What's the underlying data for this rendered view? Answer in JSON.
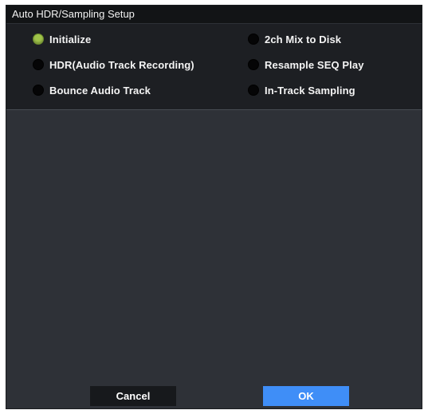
{
  "dialog": {
    "title": "Auto HDR/Sampling Setup"
  },
  "options": {
    "left_column": [
      {
        "label": "Initialize",
        "selected": true
      },
      {
        "label": "HDR(Audio Track Recording)",
        "selected": false
      },
      {
        "label": "Bounce Audio Track",
        "selected": false
      }
    ],
    "right_column": [
      {
        "label": "2ch Mix to Disk",
        "selected": false
      },
      {
        "label": "Resample SEQ Play",
        "selected": false
      },
      {
        "label": "In-Track Sampling",
        "selected": false
      }
    ]
  },
  "buttons": {
    "cancel_label": "Cancel",
    "ok_label": "OK"
  },
  "colors": {
    "dialog_background": "#2e3137",
    "options_background": "#1d1f23",
    "selected_radio": "#a0c34a",
    "ok_button": "#3f8ef7",
    "cancel_button": "#17191c"
  }
}
